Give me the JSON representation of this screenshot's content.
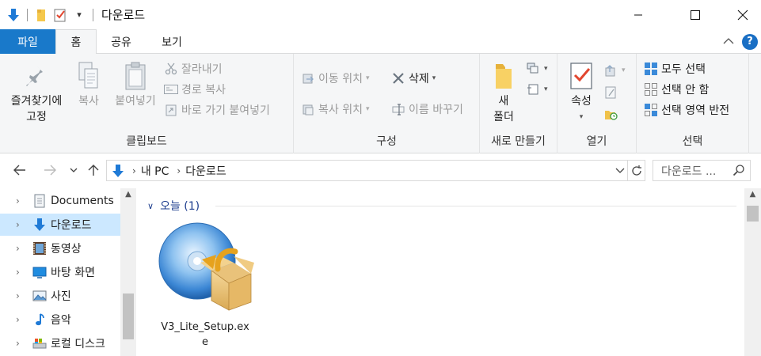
{
  "window": {
    "title": "다운로드",
    "quick_access_overflow": "▾"
  },
  "tabs": {
    "file": "파일",
    "home": "홈",
    "share": "공유",
    "view": "보기"
  },
  "ribbon": {
    "clipboard": {
      "label": "클립보드",
      "pin_line1": "즐겨찾기에",
      "pin_line2": "고정",
      "copy": "복사",
      "paste": "붙여넣기",
      "cut": "잘라내기",
      "copy_path": "경로 복사",
      "paste_shortcut": "바로 가기 붙여넣기"
    },
    "organize": {
      "label": "구성",
      "move_to": "이동 위치",
      "copy_to": "복사 위치",
      "delete": "삭제",
      "rename": "이름 바꾸기"
    },
    "new": {
      "label": "새로 만들기",
      "new_folder_line1": "새",
      "new_folder_line2": "폴더"
    },
    "open": {
      "label": "열기",
      "properties": "속성"
    },
    "select": {
      "label": "선택",
      "select_all": "모두 선택",
      "select_none": "선택 안 함",
      "invert": "선택 영역 반전"
    }
  },
  "address": {
    "crumbs": [
      "내 PC",
      "다운로드"
    ],
    "search_placeholder": "다운로드 ..."
  },
  "nav_pane": {
    "items": [
      {
        "label": "Documents",
        "icon": "documents-icon"
      },
      {
        "label": "다운로드",
        "icon": "downloads-icon",
        "selected": true
      },
      {
        "label": "동영상",
        "icon": "videos-icon"
      },
      {
        "label": "바탕 화면",
        "icon": "desktop-icon"
      },
      {
        "label": "사진",
        "icon": "pictures-icon"
      },
      {
        "label": "음악",
        "icon": "music-icon"
      },
      {
        "label": "로컬 디스크",
        "icon": "local-disk-icon"
      }
    ]
  },
  "content": {
    "group_header": "오늘 (1)",
    "files": [
      {
        "name": "V3_Lite_Setup.exe",
        "icon": "installer-icon"
      }
    ]
  },
  "colors": {
    "file_tab": "#1979ca",
    "selection": "#cce8ff",
    "group_header": "#1e3e8e",
    "ribbon_bg": "#f5f6f7"
  }
}
